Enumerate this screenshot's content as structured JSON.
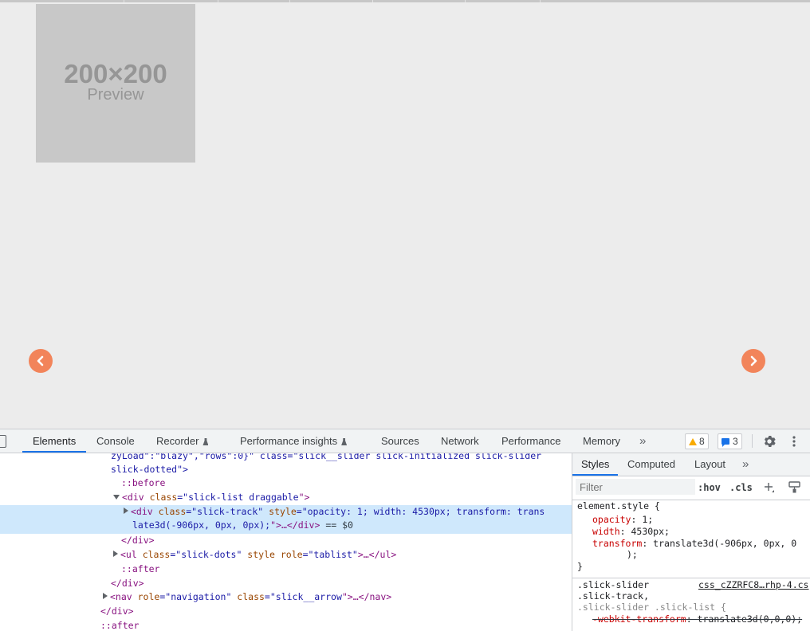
{
  "viewport": {
    "preview_size": "200×200",
    "preview_label": "Preview",
    "accent_color": "#f2845a"
  },
  "devtools": {
    "tabs": [
      "Elements",
      "Console",
      "Recorder",
      "Performance insights",
      "Sources",
      "Network",
      "Performance",
      "Memory"
    ],
    "active_tab": "Elements",
    "more_tabs": "»",
    "warnings_count": "8",
    "messages_count": "3",
    "elements": {
      "l0": "zyLoad\":\"blazy\",\"rows\":0}\" class=\"slick__slider slick-initialized slick-slider",
      "l1": "slick-dotted\">",
      "l2": "::before",
      "l3_open": "<div ",
      "l3_attr": "class",
      "l3_eq": "=\"",
      "l3_val": "slick-list draggable",
      "l3_close": "\">",
      "l4_open": "<div ",
      "l4_attr1": "class",
      "l4_val1": "slick-track",
      "l4_attr2": "style",
      "l4_val2a": "opacity: 1; width: 4530px; transform: trans",
      "l4_val2b": "late3d(-906px, 0px, 0px);",
      "l4_ellipsis": "\">…</div>",
      "l4_marker": " == $0",
      "l5": "</div>",
      "l6_open": "<ul ",
      "l6_attr1": "class",
      "l6_val1": "slick-dots",
      "l6_attr2": "style",
      "l6_attr3": "role",
      "l6_val3": "tablist",
      "l6_close": ">…</ul>",
      "l7": "::after",
      "l8": "</div>",
      "l9_open": "<nav ",
      "l9_attr1": "role",
      "l9_val1": "navigation",
      "l9_attr2": "class",
      "l9_val2": "slick__arrow",
      "l9_close": "\">…</nav>",
      "l10": "</div>",
      "l11": "::after"
    },
    "styles": {
      "tabs": [
        "Styles",
        "Computed",
        "Layout"
      ],
      "more": "»",
      "filter_placeholder": "Filter",
      "hov": ":hov",
      "cls": ".cls",
      "element_style_selector": "element.style {",
      "opacity_name": "opacity",
      "opacity_value": "1;",
      "width_name": "width",
      "width_value": "4530px;",
      "transform_name": "transform",
      "transform_value": "translate3d(-906px, 0px, 0",
      "transform_tail": ");",
      "close_brace": "}",
      "rule2_selector_1": ".slick-slider",
      "rule2_source": "css_cZZRFC8…rhp-4.cs",
      "rule2_selector_2": ".slick-track,",
      "rule2_selector_3": ".slick-slider .slick-list {",
      "rule2_prop": "-webkit-transform",
      "rule2_value": "translate3d(0,0,0);"
    }
  }
}
